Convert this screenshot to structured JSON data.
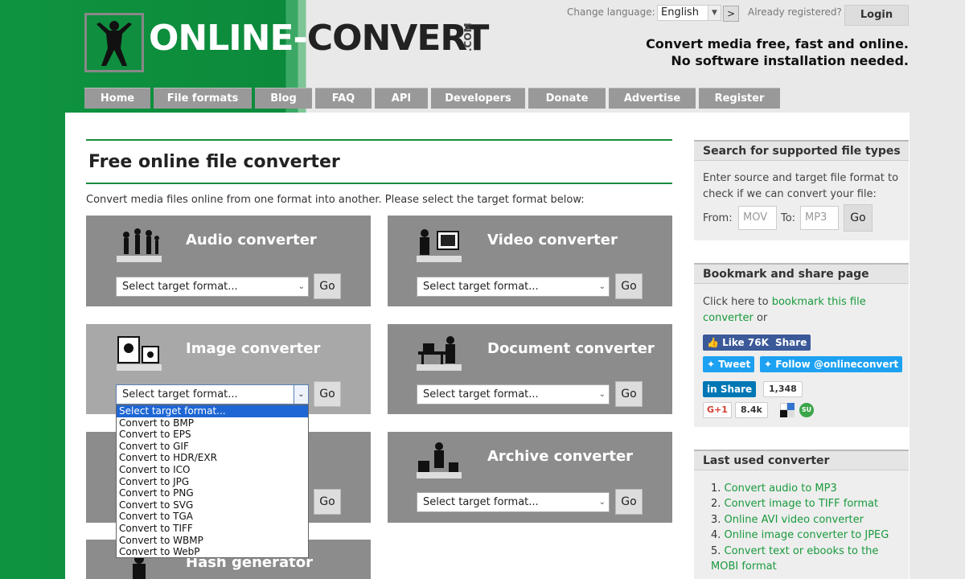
{
  "header": {
    "logo_text_1": "ONLINE-",
    "logo_text_2": "CONVERT",
    "logo_com": ".COM",
    "change_language_label": "Change language:",
    "language_value": "English",
    "language_go": ">",
    "already_registered": "Already registered?",
    "login_label": "Login",
    "tagline_1": "Convert media free, fast and online.",
    "tagline_2": "No software installation needed."
  },
  "nav": [
    {
      "label": "Home"
    },
    {
      "label": "File formats"
    },
    {
      "label": "Blog"
    },
    {
      "label": "FAQ"
    },
    {
      "label": "API"
    },
    {
      "label": "Developers"
    },
    {
      "label": "Donate"
    },
    {
      "label": "Advertise"
    },
    {
      "label": "Register"
    }
  ],
  "main": {
    "title": "Free online file converter",
    "intro": "Convert media files online from one format into another. Please select the target format below:",
    "select_placeholder": "Select target format...",
    "go_label": "Go",
    "converters": {
      "audio": "Audio converter",
      "video": "Video converter",
      "image": "Image converter",
      "document": "Document converter",
      "archive": "Archive converter",
      "hash": "Hash generator"
    },
    "dropdown_options": [
      "Select target format...",
      "Convert to BMP",
      "Convert to EPS",
      "Convert to GIF",
      "Convert to HDR/EXR",
      "Convert to ICO",
      "Convert to JPG",
      "Convert to PNG",
      "Convert to SVG",
      "Convert to TGA",
      "Convert to TIFF",
      "Convert to WBMP",
      "Convert to WebP"
    ]
  },
  "sidebar": {
    "search": {
      "title": "Search for supported file types",
      "text": "Enter source and target file format to check if we can convert your file:",
      "from_label": "From:",
      "from_placeholder": "MOV",
      "to_label": "To:",
      "to_placeholder": "MP3",
      "go_label": "Go"
    },
    "bookmark": {
      "title": "Bookmark and share page",
      "text_1": "Click here to ",
      "link": "bookmark this file converter",
      "text_2": " or",
      "fb_like": "Like 76K",
      "fb_share": "Share",
      "tweet": "Tweet",
      "follow": "Follow @onlineconvert",
      "li_share": "Share",
      "li_count": "1,348",
      "gplus": "G+1",
      "gplus_count": "8.4k"
    },
    "last_used": {
      "title": "Last used converter",
      "items": [
        {
          "num": "1.",
          "label": "Convert audio to MP3"
        },
        {
          "num": "2.",
          "label": "Convert image to TIFF format"
        },
        {
          "num": "3.",
          "label": "Online AVI video converter"
        },
        {
          "num": "4.",
          "label": "Online image converter to JPEG"
        },
        {
          "num": "5.",
          "label": "Convert text or ebooks to the MOBI format"
        }
      ]
    }
  }
}
